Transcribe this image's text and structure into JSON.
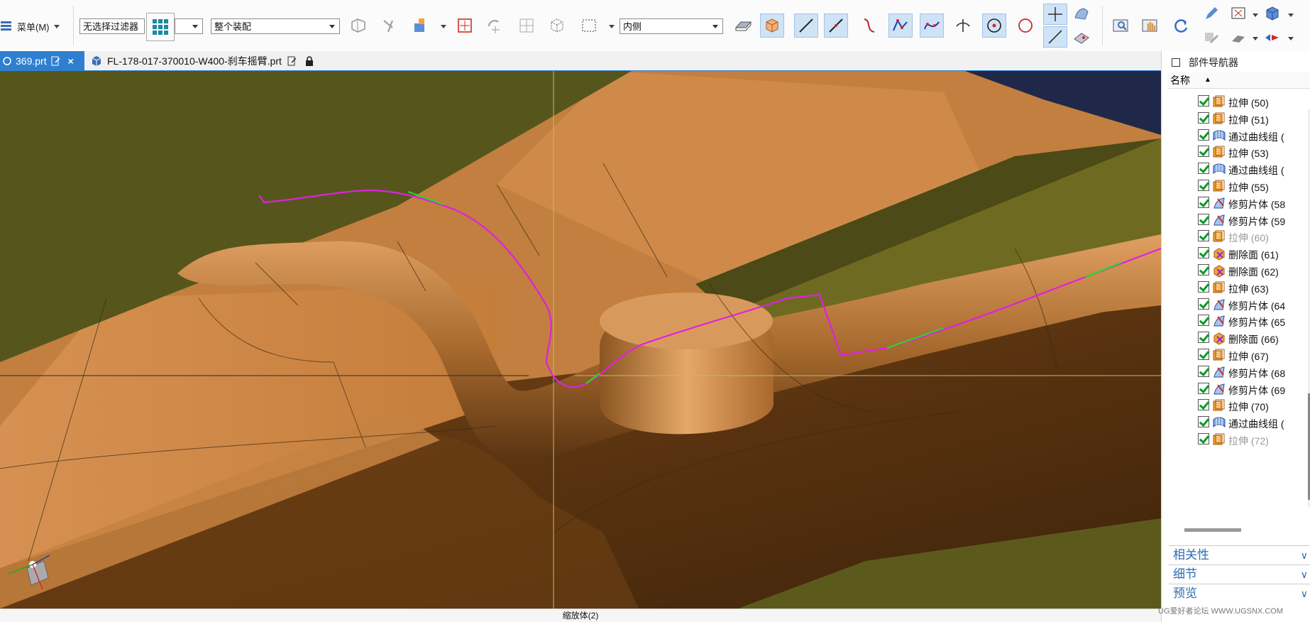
{
  "toolbar": {
    "menu_label": "菜单(M)",
    "filter_value": "无选择过滤器",
    "assembly_value": "整个装配",
    "side_value": "内侧"
  },
  "tabs": [
    {
      "label": "369.prt"
    },
    {
      "label": "FL-178-017-370010-W400-刹车摇臂.prt"
    }
  ],
  "status": {
    "text": "缩放体(2)"
  },
  "navigator": {
    "title": "部件导航器",
    "column_header": "名称",
    "items": [
      {
        "label": "拉伸 (50)",
        "icon": "extrude-icon"
      },
      {
        "label": "拉伸 (51)",
        "icon": "extrude-icon"
      },
      {
        "label": "通过曲线组 (",
        "icon": "through-curves-icon"
      },
      {
        "label": "拉伸 (53)",
        "icon": "extrude-icon"
      },
      {
        "label": "通过曲线组 (",
        "icon": "through-curves-icon"
      },
      {
        "label": "拉伸 (55)",
        "icon": "extrude-icon"
      },
      {
        "label": "修剪片体 (58",
        "icon": "trim-sheet-icon"
      },
      {
        "label": "修剪片体 (59",
        "icon": "trim-sheet-icon"
      },
      {
        "label": "拉伸 (60)",
        "icon": "extrude-icon"
      },
      {
        "label": "删除面 (61)",
        "icon": "delete-face-icon"
      },
      {
        "label": "删除面 (62)",
        "icon": "delete-face-icon"
      },
      {
        "label": "拉伸 (63)",
        "icon": "extrude-icon"
      },
      {
        "label": "修剪片体 (64",
        "icon": "trim-sheet-icon"
      },
      {
        "label": "修剪片体 (65",
        "icon": "trim-sheet-icon"
      },
      {
        "label": "删除面 (66)",
        "icon": "delete-face-icon"
      },
      {
        "label": "拉伸 (67)",
        "icon": "extrude-icon"
      },
      {
        "label": "修剪片体 (68",
        "icon": "trim-sheet-icon"
      },
      {
        "label": "修剪片体 (69",
        "icon": "trim-sheet-icon"
      },
      {
        "label": "拉伸 (70)",
        "icon": "extrude-icon"
      },
      {
        "label": "通过曲线组 (",
        "icon": "through-curves-icon"
      },
      {
        "label": "拉伸 (72)",
        "icon": "extrude-icon"
      }
    ],
    "sections": [
      "相关性",
      "细节",
      "预览"
    ]
  },
  "watermark": "UG爱好者论坛 WWW.UGSNX.COM",
  "colors": {
    "accent": "#2f7fd0",
    "highlight_curve": "#e020e0",
    "edge_green": "#22dd22",
    "model_copper": "#c5813f",
    "olive_plate": "#5a5a1c"
  }
}
